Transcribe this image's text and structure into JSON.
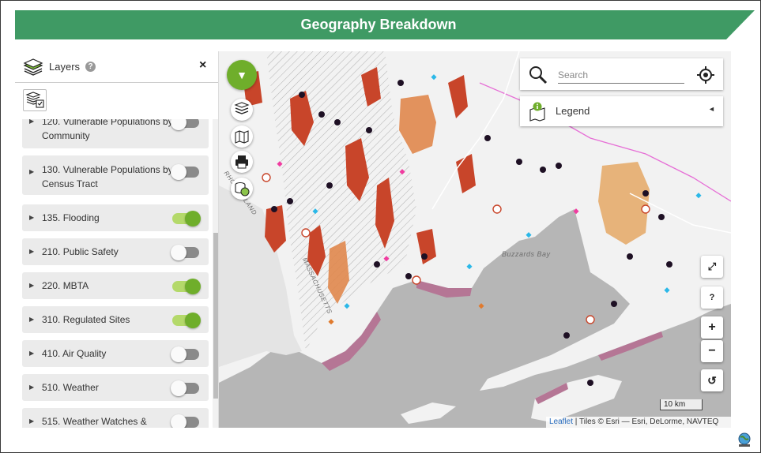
{
  "banner": {
    "title": "Geography Breakdown",
    "color": "#3f9a64"
  },
  "panel": {
    "title": "Layers",
    "help": "?",
    "close": "×",
    "layers": [
      {
        "label": "120. Vulnerable Populations by Community",
        "on": false
      },
      {
        "label": "130. Vulnerable Populations by Census Tract",
        "on": false
      },
      {
        "label": "135. Flooding",
        "on": true
      },
      {
        "label": "210. Public Safety",
        "on": false
      },
      {
        "label": "220. MBTA",
        "on": true
      },
      {
        "label": "310. Regulated Sites",
        "on": true
      },
      {
        "label": "410. Air Quality",
        "on": false
      },
      {
        "label": "510. Weather",
        "on": false
      },
      {
        "label": "515. Weather Watches &",
        "on": false
      }
    ]
  },
  "map": {
    "search_placeholder": "Search",
    "legend_label": "Legend",
    "legend_toggle": "◄",
    "help_button": "?",
    "zoom_in": "+",
    "zoom_out": "−",
    "reset": "↺",
    "expand": "⤢",
    "scale": "10 km",
    "attribution_link": "Leaflet",
    "attribution_text": " | Tiles © Esri — Esri, DeLorme, NAVTEQ",
    "place_label": "Buzzards Bay",
    "coast_label_1": "RHODE ISLAND",
    "coast_label_2": "MASSACHUSETTS",
    "colors": {
      "land": "#f2f2f2",
      "water": "#b6b6b6",
      "flood": "#c8452a",
      "flood_light": "#e0874d",
      "marsh": "#b57695",
      "accent": "#6fae2b"
    }
  }
}
